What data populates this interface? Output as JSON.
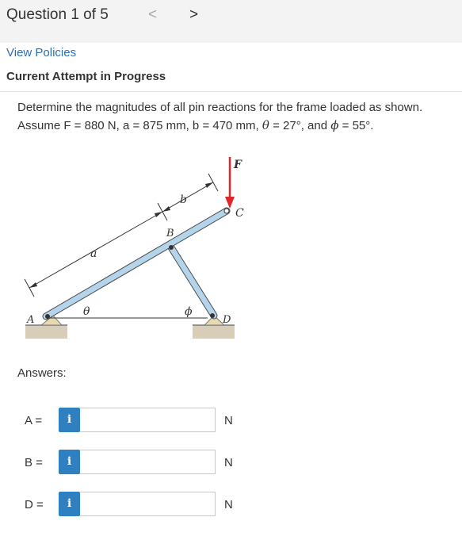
{
  "header": {
    "title": "Question 1 of 5",
    "prev": "<",
    "next": ">"
  },
  "links": {
    "view_policies": "View Policies"
  },
  "status": {
    "attempt": "Current Attempt in Progress"
  },
  "problem": {
    "line1": "Determine the magnitudes of all pin reactions for the frame loaded as shown.",
    "line2_prefix": "Assume F = 880 N, a = 875 mm, b = 470 mm, ",
    "theta_sym": "θ",
    "eq1": " =  27°, and ",
    "phi_sym": "ϕ",
    "eq2": " =  55°."
  },
  "figure": {
    "label_F": "F",
    "label_C": "C",
    "label_b": "b",
    "label_B": "B",
    "label_a": "a",
    "label_A": "A",
    "label_theta": "θ",
    "label_phi": "ϕ",
    "label_D": "D",
    "force_color": "#e2252b",
    "member_color": "#b3d4ea"
  },
  "answers": {
    "heading": "Answers:",
    "info_icon": "i",
    "rows": [
      {
        "label": "A =",
        "value": "",
        "unit": "N"
      },
      {
        "label": "B =",
        "value": "",
        "unit": "N"
      },
      {
        "label": "D =",
        "value": "",
        "unit": "N"
      }
    ]
  }
}
